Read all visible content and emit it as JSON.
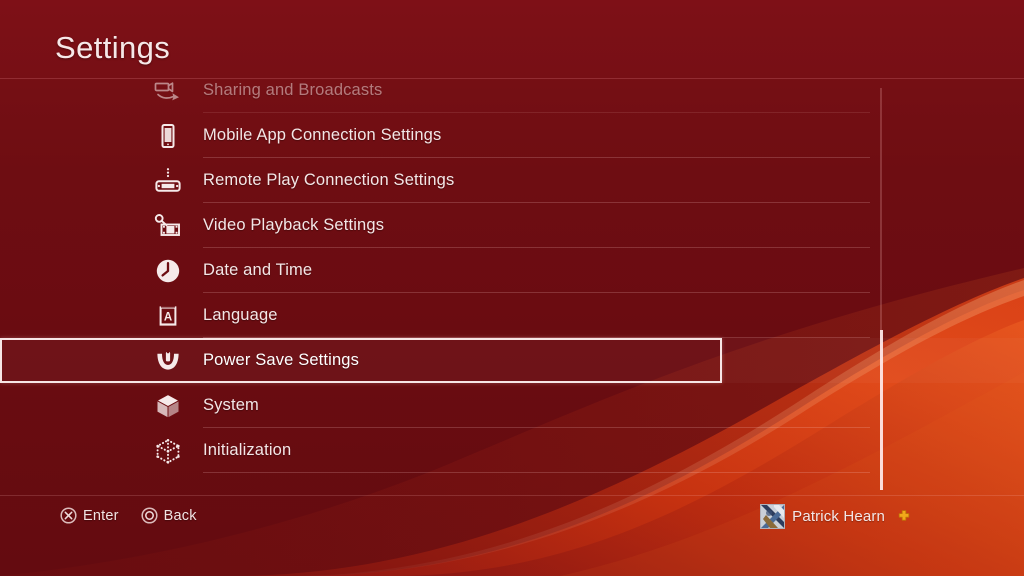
{
  "header": {
    "title": "Settings"
  },
  "colors": {
    "background_top": "#7d1016",
    "background_bottom": "#640b10",
    "wave_bright": "#e2431a",
    "wave_mid": "#c22a14",
    "text": "#f3e6e6",
    "selection_border": "#f7e6e6",
    "ps_plus_gold": "#f0a818"
  },
  "menu": {
    "items": [
      {
        "label": "Sharing and Broadcasts",
        "icon": "sharing-broadcast-icon",
        "selected": false,
        "clipped": true
      },
      {
        "label": "Mobile App Connection Settings",
        "icon": "mobile-phone-icon",
        "selected": false,
        "clipped": false
      },
      {
        "label": "Remote Play Connection Settings",
        "icon": "remote-play-device-icon",
        "selected": false,
        "clipped": false
      },
      {
        "label": "Video Playback Settings",
        "icon": "film-strip-icon",
        "selected": false,
        "clipped": false
      },
      {
        "label": "Date and Time",
        "icon": "clock-icon",
        "selected": false,
        "clipped": false
      },
      {
        "label": "Language",
        "icon": "language-book-icon",
        "selected": false,
        "clipped": false
      },
      {
        "label": "Power Save Settings",
        "icon": "power-save-icon",
        "selected": true,
        "clipped": false
      },
      {
        "label": "System",
        "icon": "cube-icon",
        "selected": false,
        "clipped": false
      },
      {
        "label": "Initialization",
        "icon": "dotted-cube-icon",
        "selected": false,
        "clipped": false
      }
    ]
  },
  "footer": {
    "hints": [
      {
        "button": "cross-button-icon",
        "label": "Enter"
      },
      {
        "button": "circle-button-icon",
        "label": "Back"
      }
    ],
    "user": {
      "name": "Patrick Hearn",
      "avatar": "user-avatar",
      "badge": "ps-plus-icon"
    }
  },
  "scrollbar": {
    "name": "vertical-scrollbar"
  }
}
